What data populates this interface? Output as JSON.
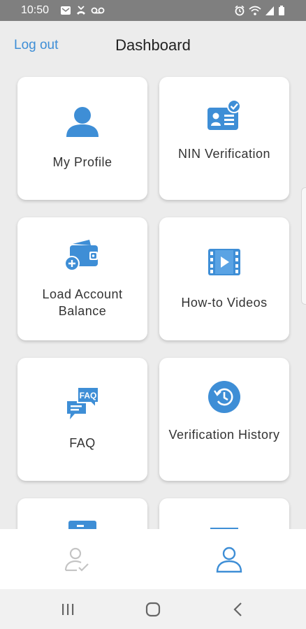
{
  "status_bar": {
    "time": "10:50",
    "left_icons": [
      "mail-icon",
      "missed-call-icon",
      "voicemail-icon"
    ],
    "right_icons": [
      "alarm-icon",
      "wifi-icon",
      "signal-icon",
      "battery-icon"
    ]
  },
  "header": {
    "logout_label": "Log out",
    "title": "Dashboard"
  },
  "tiles": [
    {
      "label": "My Profile",
      "icon": "user-icon"
    },
    {
      "label": "NIN Verification",
      "icon": "id-card-check-icon"
    },
    {
      "label": "Load Account Balance",
      "icon": "wallet-add-icon"
    },
    {
      "label": "How-to Videos",
      "icon": "film-play-icon"
    },
    {
      "label": "FAQ",
      "icon": "faq-chat-icon"
    },
    {
      "label": "Verification History",
      "icon": "history-icon"
    }
  ],
  "bottom_tabs": [
    {
      "icon": "user-check-icon",
      "active": false
    },
    {
      "icon": "user-icon",
      "active": true
    }
  ],
  "colors": {
    "accent": "#3e8ed6",
    "background": "#ececec",
    "card": "#ffffff",
    "status_bar": "#7f7f7f"
  }
}
